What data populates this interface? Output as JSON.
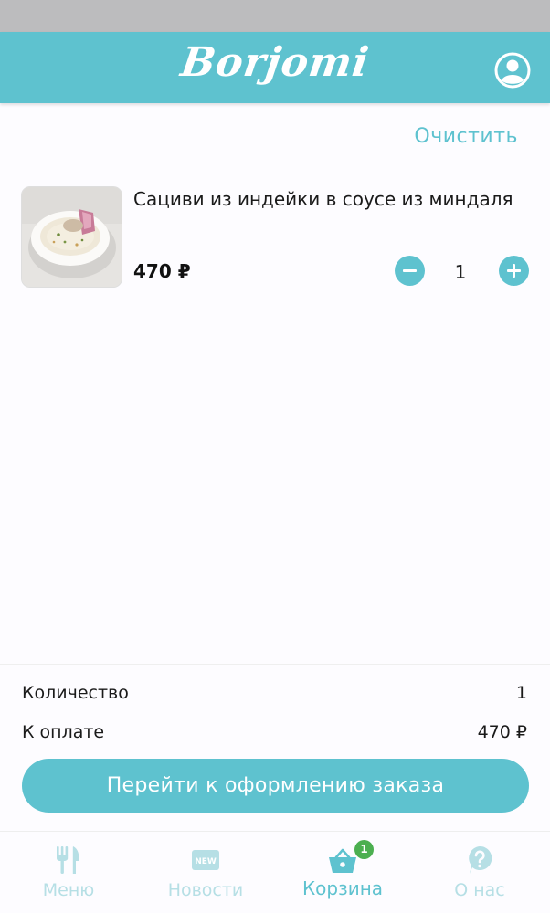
{
  "header": {
    "logo_text": "Borjomi"
  },
  "cart": {
    "clear_label": "Очистить",
    "items": [
      {
        "title": "Сациви из индейки в соусе из миндаля",
        "price": "470 ₽",
        "quantity": "1"
      }
    ]
  },
  "summary": {
    "quantity_label": "Количество",
    "quantity_value": "1",
    "total_label": "К оплате",
    "total_value": "470 ₽",
    "checkout_label": "Перейти к оформлению заказа"
  },
  "nav": {
    "items": [
      {
        "label": "Меню",
        "icon": "fork-knife-icon",
        "active": false
      },
      {
        "label": "Новости",
        "icon": "new-badge-icon",
        "icon_text": "NEW",
        "active": false
      },
      {
        "label": "Корзина",
        "icon": "basket-icon",
        "active": true,
        "badge": "1"
      },
      {
        "label": "О нас",
        "icon": "question-icon",
        "active": false
      }
    ]
  },
  "colors": {
    "accent": "#5ec2cf",
    "accent_light": "#b6dfe5",
    "badge": "#4caf50",
    "status_bar": "#bcbcbe"
  }
}
